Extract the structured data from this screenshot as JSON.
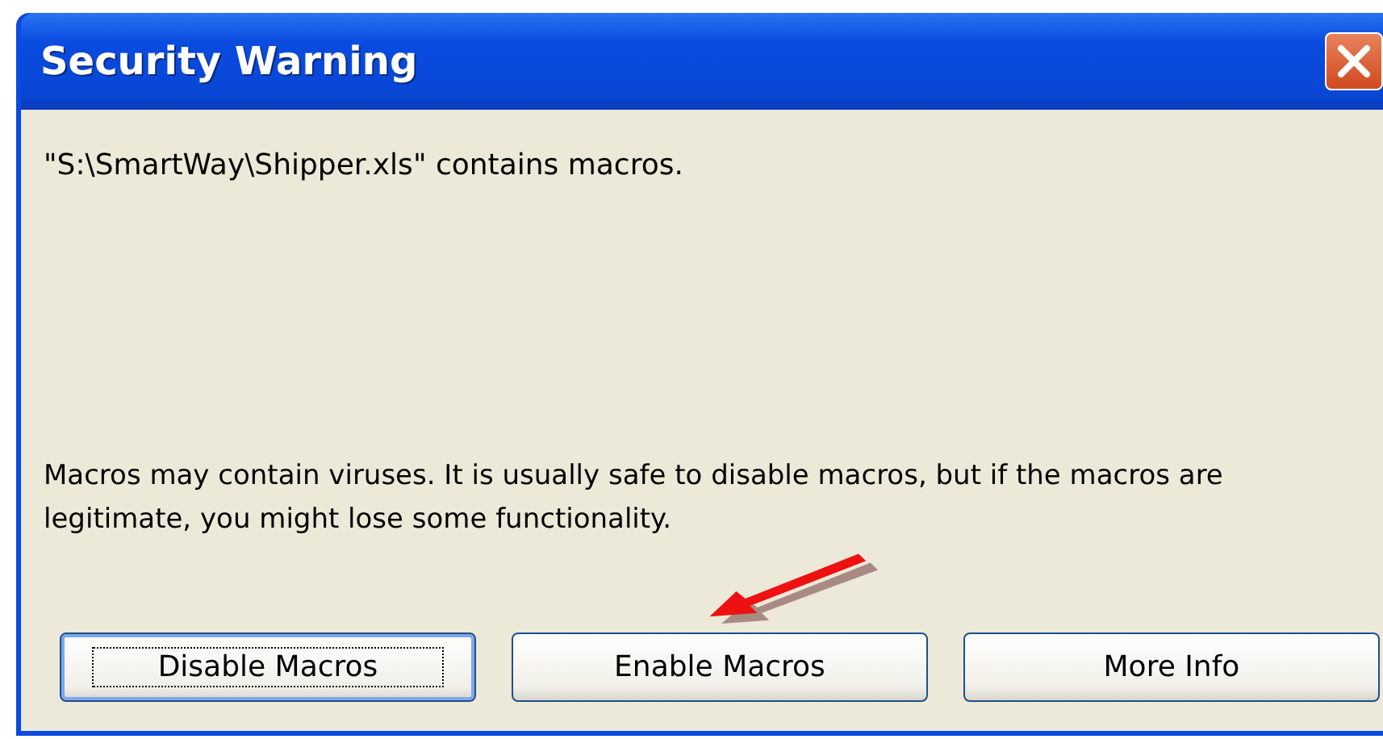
{
  "window": {
    "title": "Security Warning"
  },
  "message": "\"S:\\SmartWay\\Shipper.xls\" contains macros.",
  "warning": "Macros may contain viruses. It is usually safe to disable macros, but if the macros are legitimate, you might lose some functionality.",
  "buttons": [
    {
      "label": "Disable Macros",
      "focused": true
    },
    {
      "label": "Enable Macros",
      "focused": false
    },
    {
      "label": "More Info",
      "focused": false
    }
  ]
}
